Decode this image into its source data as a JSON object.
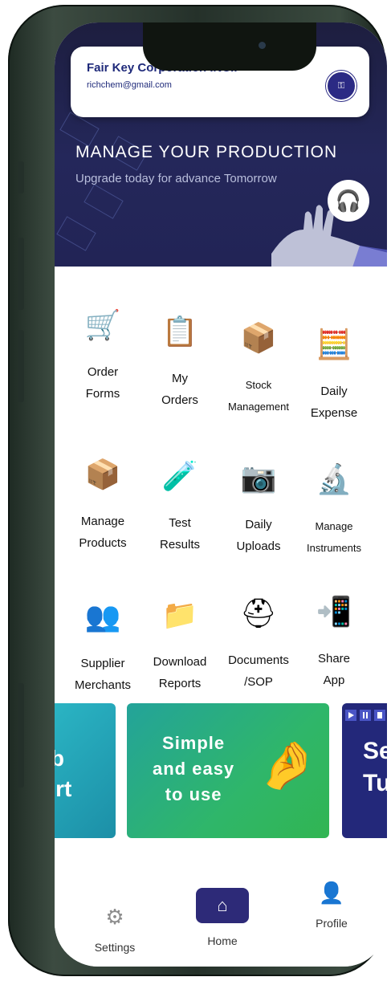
{
  "header": {
    "company_name": "Fair Key Corporation INC..",
    "email": "richchem@gmail.com",
    "logo_icon": "company-logo"
  },
  "banner": {
    "title": "MANAGE YOUR PRODUCTION",
    "subtitle": "Upgrade today for advance Tomorrow",
    "support_icon": "headset-icon"
  },
  "menu": [
    {
      "label": "Order\nForms",
      "icon": "cart-icon"
    },
    {
      "label": "My\nOrders",
      "icon": "clipboard-icon"
    },
    {
      "label": "Stock\nManagement",
      "icon": "boxes-icon"
    },
    {
      "label": "Daily\nExpense",
      "icon": "calculator-icon"
    },
    {
      "label": "Manage\nProducts",
      "icon": "box-icon"
    },
    {
      "label": "Test\nResults",
      "icon": "test-tubes-icon"
    },
    {
      "label": "Daily\nUploads",
      "icon": "camera-icon"
    },
    {
      "label": "Manage\nInstruments",
      "icon": "microscope-icon"
    },
    {
      "label": "Supplier\nMerchants",
      "icon": "people-icon"
    },
    {
      "label": "Download\nReports",
      "icon": "folder-icon"
    },
    {
      "label": "Documents\n/SOP",
      "icon": "helmet-gear-icon"
    },
    {
      "label": "Share\nApp",
      "icon": "share-icon"
    }
  ],
  "promos": {
    "left_text": "rb\nort",
    "center_text": "Simple\nand easy\nto use",
    "right_text": "Se\nTut"
  },
  "nav": {
    "settings": "Settings",
    "home": "Home",
    "profile": "Profile"
  }
}
